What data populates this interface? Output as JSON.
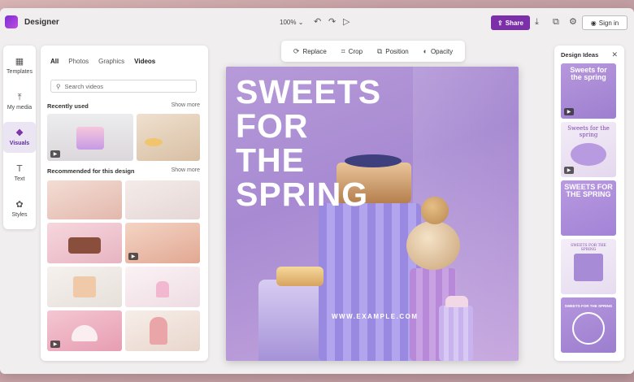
{
  "app": {
    "name": "Designer"
  },
  "topbar": {
    "zoom": "100%",
    "share_label": "Share",
    "signin_label": "Sign in"
  },
  "rail": {
    "items": [
      {
        "label": "Templates",
        "icon": "templates-icon"
      },
      {
        "label": "My media",
        "icon": "upload-icon"
      },
      {
        "label": "Visuals",
        "icon": "visuals-icon"
      },
      {
        "label": "Text",
        "icon": "text-icon"
      },
      {
        "label": "Styles",
        "icon": "styles-icon"
      }
    ]
  },
  "media": {
    "tabs": [
      "All",
      "Photos",
      "Graphics",
      "Videos"
    ],
    "search_placeholder": "Search videos",
    "recent_title": "Recently used",
    "recommended_title": "Recommended for this design",
    "show_more": "Show more"
  },
  "toolbar": {
    "items": [
      "Replace",
      "Crop",
      "Position",
      "Opacity"
    ]
  },
  "poster": {
    "headline": [
      "SWEETS",
      "FOR",
      "THE",
      "SPRING"
    ],
    "url": "WWW.EXAMPLE.COM"
  },
  "ideas": {
    "title": "Design Ideas",
    "cards": [
      {
        "text": "Sweets for the spring"
      },
      {
        "text": "Sweets for the spring"
      },
      {
        "text": "SWEETS FOR THE SPRING"
      },
      {
        "text": "SWEETS FOR THE SPRING"
      },
      {
        "text": "SWEETS FOR THE SPRING"
      }
    ]
  },
  "colors": {
    "accent": "#7b2fa8",
    "poster_bg": "#a98bd3"
  }
}
